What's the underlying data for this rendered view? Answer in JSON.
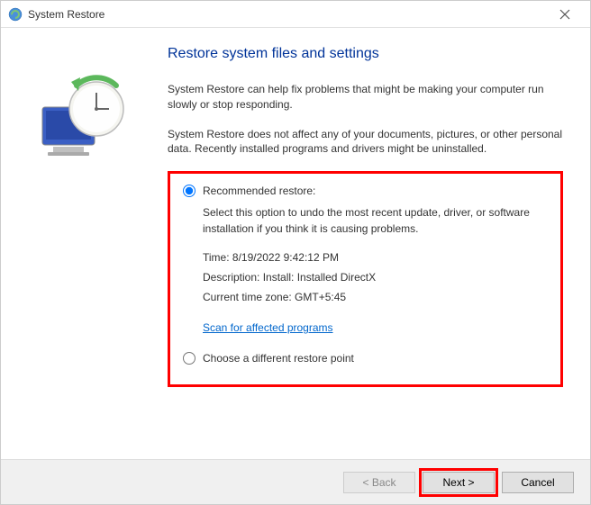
{
  "titlebar": {
    "title": "System Restore"
  },
  "heading": "Restore system files and settings",
  "paragraph1": "System Restore can help fix problems that might be making your computer run slowly or stop responding.",
  "paragraph2": "System Restore does not affect any of your documents, pictures, or other personal data. Recently installed programs and drivers might be uninstalled.",
  "options": {
    "recommended": {
      "label": "Recommended restore:",
      "description": "Select this option to undo the most recent update, driver, or software installation if you think it is causing problems.",
      "time_label": "Time: ",
      "time_value": "8/19/2022 9:42:12 PM",
      "desc_label": "Description: ",
      "desc_value": "Install: Installed DirectX",
      "tz_label": "Current time zone: ",
      "tz_value": "GMT+5:45",
      "scan_link": "Scan for affected programs"
    },
    "different": {
      "label": "Choose a different restore point"
    }
  },
  "footer": {
    "back": "< Back",
    "next": "Next >",
    "cancel": "Cancel"
  }
}
